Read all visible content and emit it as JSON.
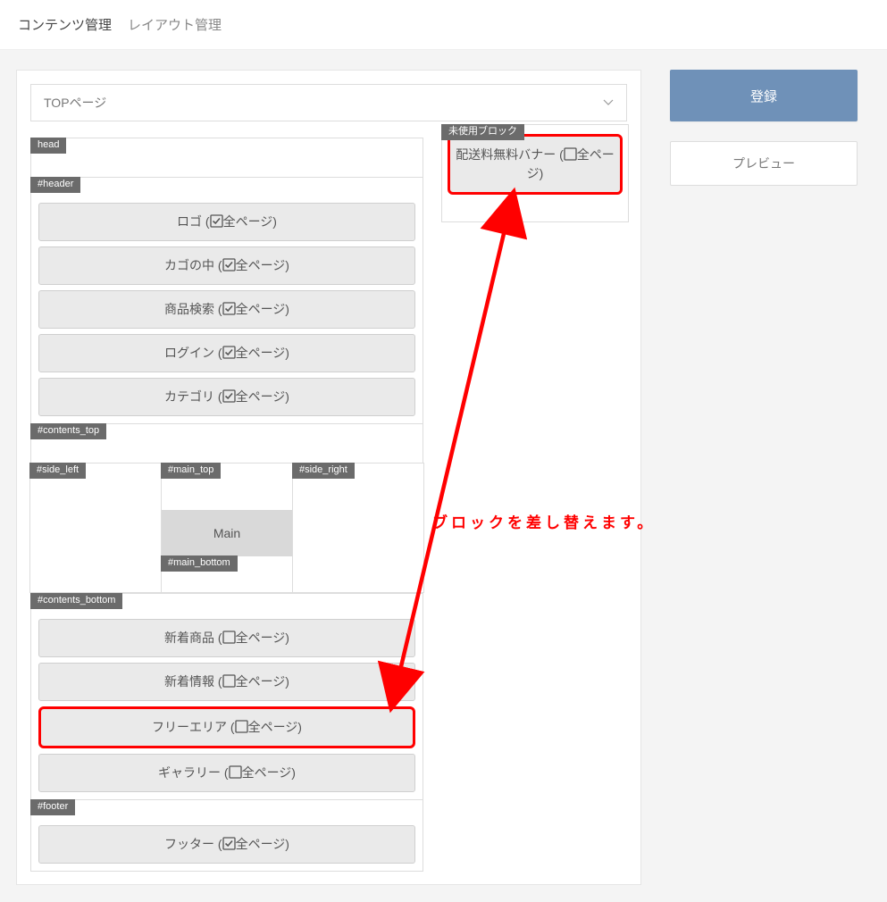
{
  "breadcrumb": {
    "primary": "コンテンツ管理",
    "secondary": "レイアウト管理"
  },
  "actions": {
    "register": "登録",
    "preview": "プレビュー"
  },
  "page_select": {
    "value": "TOPページ"
  },
  "sections": {
    "head": "head",
    "header": "#header",
    "contents_top": "#contents_top",
    "side_left": "#side_left",
    "main_top": "#main_top",
    "main_bottom": "#main_bottom",
    "side_right": "#side_right",
    "contents_bottom": "#contents_bottom",
    "footer": "#footer",
    "main_label": "Main",
    "unused": "未使用ブロック"
  },
  "all_label": "全ページ",
  "blocks": {
    "header": [
      {
        "name": "ロゴ",
        "checked": true
      },
      {
        "name": "カゴの中",
        "checked": true
      },
      {
        "name": "商品検索",
        "checked": true
      },
      {
        "name": "ログイン",
        "checked": true
      },
      {
        "name": "カテゴリ",
        "checked": true
      }
    ],
    "contents_bottom": [
      {
        "name": "新着商品",
        "checked": false
      },
      {
        "name": "新着情報",
        "checked": false
      },
      {
        "name": "フリーエリア",
        "checked": false,
        "highlight": true
      },
      {
        "name": "ギャラリー",
        "checked": false
      }
    ],
    "footer": [
      {
        "name": "フッター",
        "checked": true
      }
    ],
    "unused": [
      {
        "name": "配送料無料バナー",
        "checked": false,
        "highlight": true
      }
    ]
  },
  "annotation": {
    "text": "ブロックを差し替えます。"
  }
}
